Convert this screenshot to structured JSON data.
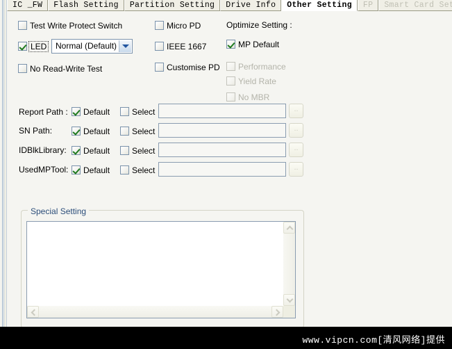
{
  "tabs": [
    {
      "label": "IC _FW",
      "state": "normal"
    },
    {
      "label": "Flash Setting",
      "state": "normal"
    },
    {
      "label": "Partition Setting",
      "state": "normal"
    },
    {
      "label": "Drive Info",
      "state": "normal"
    },
    {
      "label": "Other Setting",
      "state": "active"
    },
    {
      "label": "FP",
      "state": "disabled"
    },
    {
      "label": "Smart Card Setting",
      "state": "disabled"
    }
  ],
  "left_column": {
    "test_write_protect": {
      "label": "Test Write Protect Switch",
      "checked": false
    },
    "led": {
      "label": "LED",
      "checked": true
    },
    "led_mode": {
      "value": "Normal (Default)",
      "options": [
        "Normal (Default)"
      ]
    },
    "no_read_write_test": {
      "label": "No Read-Write Test",
      "checked": false
    }
  },
  "middle_column": {
    "micro_pd": {
      "label": "Micro PD",
      "checked": false
    },
    "ieee_1667": {
      "label": "IEEE 1667",
      "checked": false
    },
    "customise_pd": {
      "label": "Customise PD",
      "checked": false
    }
  },
  "optimize": {
    "title": "Optimize Setting :",
    "items": [
      {
        "label": "MP Default",
        "checked": true,
        "disabled": false
      },
      {
        "label": "Performance",
        "checked": false,
        "disabled": true
      },
      {
        "label": "Yield Rate",
        "checked": false,
        "disabled": true
      },
      {
        "label": "No MBR",
        "checked": false,
        "disabled": true
      }
    ]
  },
  "paths": {
    "default_label": "Default",
    "select_label": "Select",
    "browse_label": "..",
    "rows": [
      {
        "label": "Report Path :",
        "default_checked": true,
        "select_checked": false,
        "value": ""
      },
      {
        "label": "SN Path:",
        "default_checked": true,
        "select_checked": false,
        "value": ""
      },
      {
        "label": "IDBlkLibrary:",
        "default_checked": true,
        "select_checked": false,
        "value": ""
      },
      {
        "label": "UsedMPTool:",
        "default_checked": true,
        "select_checked": false,
        "value": ""
      }
    ]
  },
  "special_setting": {
    "title": "Special Setting",
    "text": ""
  },
  "watermark": {
    "text": "www.vipcn.com[清风网络]提供"
  },
  "colors": {
    "background": "#f5f5f1",
    "check_green": "#1e7a1e",
    "group_title": "#2c4e7a",
    "field_border": "#8a9cb0",
    "band": "#000000"
  }
}
